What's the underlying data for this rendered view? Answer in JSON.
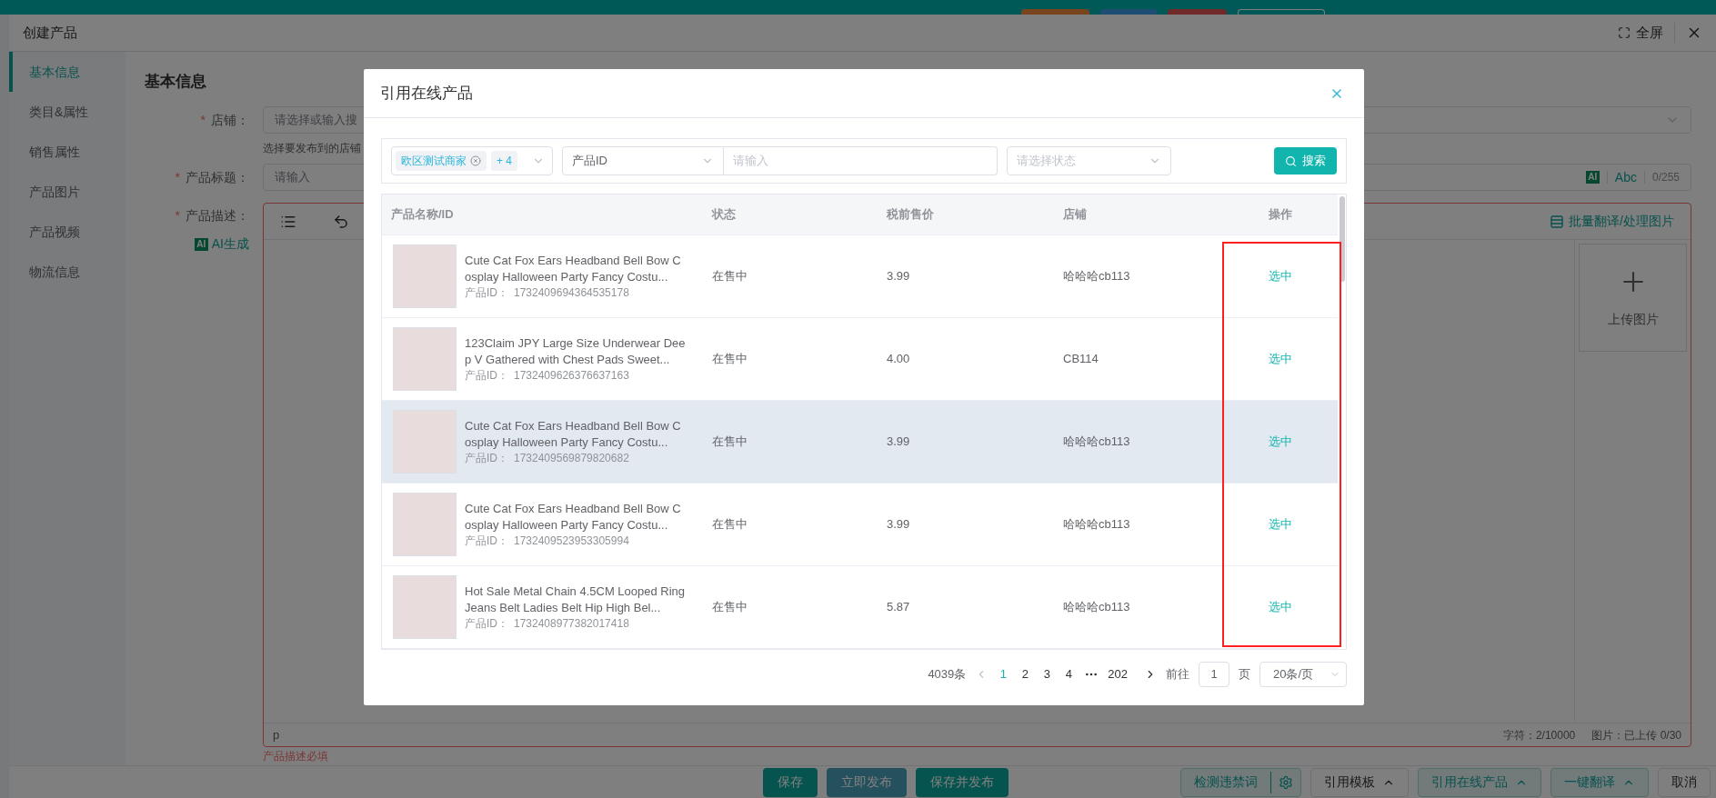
{
  "drawer": {
    "title": "创建产品",
    "fullscreen_label": "全屏",
    "sidebar": {
      "items": [
        {
          "label": "基本信息",
          "selected": true
        },
        {
          "label": "类目&属性",
          "selected": false
        },
        {
          "label": "销售属性",
          "selected": false
        },
        {
          "label": "产品图片",
          "selected": false
        },
        {
          "label": "产品视频",
          "selected": false
        },
        {
          "label": "物流信息",
          "selected": false
        }
      ]
    },
    "section_title": "基本信息",
    "store_field": {
      "required_mark": "*",
      "label": "店铺：",
      "placeholder": "请选择或输入搜",
      "hint": "选择要发布到的店铺"
    },
    "title_field": {
      "required_mark": "*",
      "label": "产品标题：",
      "placeholder": "请输入",
      "ai_badge": "AI",
      "case_button": "Abc",
      "counter": "0/255"
    },
    "description_field": {
      "required_mark": "*",
      "label": "产品描述：",
      "ai_badge": "AI",
      "ai_generate": "AI生成",
      "batch_action": "批量翻译/处理图片",
      "upload_label": "上传图片",
      "path": "p",
      "char_count": "字符：2/10000",
      "image_count": "图片：已上传 0/30",
      "error": "产品描述必填"
    },
    "footer": {
      "center_buttons": [
        {
          "label": "保存",
          "disabled": false
        },
        {
          "label": "立即发布",
          "disabled": true
        },
        {
          "label": "保存并发布",
          "disabled": false
        }
      ],
      "right_buttons": [
        {
          "label": "检测违禁词",
          "kind": "split"
        },
        {
          "label": "引用模板",
          "kind": "dropdown"
        },
        {
          "label": "引用在线产品",
          "kind": "dropdown"
        },
        {
          "label": "一键翻译",
          "kind": "dropdown"
        },
        {
          "label": "取消",
          "kind": "plain"
        }
      ]
    }
  },
  "modal": {
    "title": "引用在线产品",
    "filters": {
      "store_tags": [
        {
          "label": "欧区测试商家"
        }
      ],
      "more_count": "+ 4",
      "field_select": "产品ID",
      "keyword_placeholder": "请输入",
      "status_placeholder": "请选择状态",
      "search_button": "搜索"
    },
    "table": {
      "columns": [
        "产品名称/ID",
        "状态",
        "税前售价",
        "店铺",
        "操作"
      ],
      "rows": [
        {
          "name": "Cute Cat Fox Ears Headband Bell Bow Cosplay Halloween Party Fancy Costu...",
          "id_label": "产品ID：",
          "id": "1732409694364535178",
          "status": "在售中",
          "price": "3.99",
          "store": "哈哈哈cb113",
          "action": "选中",
          "hovered": false
        },
        {
          "name": "123Claim JPY Large Size Underwear Deep V Gathered with Chest Pads Sweet...",
          "id_label": "产品ID：",
          "id": "1732409626376637163",
          "status": "在售中",
          "price": "4.00",
          "store": "CB114",
          "action": "选中",
          "hovered": false
        },
        {
          "name": "Cute Cat Fox Ears Headband Bell Bow Cosplay Halloween Party Fancy Costu...",
          "id_label": "产品ID：",
          "id": "1732409569879820682",
          "status": "在售中",
          "price": "3.99",
          "store": "哈哈哈cb113",
          "action": "选中",
          "hovered": true
        },
        {
          "name": "Cute Cat Fox Ears Headband Bell Bow Cosplay Halloween Party Fancy Costu...",
          "id_label": "产品ID：",
          "id": "1732409523953305994",
          "status": "在售中",
          "price": "3.99",
          "store": "哈哈哈cb113",
          "action": "选中",
          "hovered": false
        },
        {
          "name": "Hot Sale Metal Chain 4.5CM Looped Ring Jeans Belt Ladies Belt Hip High Bel...",
          "id_label": "产品ID：",
          "id": "1732408977382017418",
          "status": "在售中",
          "price": "5.87",
          "store": "哈哈哈cb113",
          "action": "选中",
          "hovered": false
        }
      ]
    },
    "pagination": {
      "total": "4039条",
      "pages": [
        {
          "label": "1",
          "selected": true
        },
        {
          "label": "2",
          "selected": false
        },
        {
          "label": "3",
          "selected": false
        },
        {
          "label": "4",
          "selected": false
        },
        {
          "label": "202",
          "selected": false
        }
      ],
      "goto_label": "前往",
      "goto_value": "1",
      "page_unit": "页",
      "page_size": "20条/页"
    }
  }
}
